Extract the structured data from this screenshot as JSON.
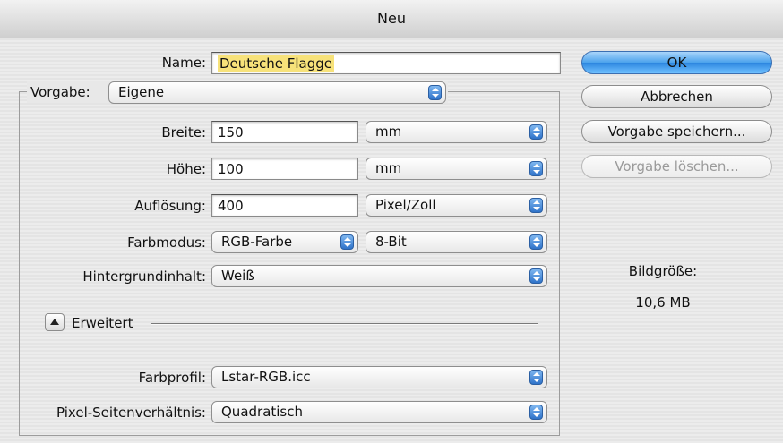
{
  "window": {
    "title": "Neu"
  },
  "name_field": {
    "label": "Name:",
    "value": "Deutsche Flagge"
  },
  "preset": {
    "label": "Vorgabe:",
    "value": "Eigene"
  },
  "width": {
    "label": "Breite:",
    "value": "150",
    "unit": "mm"
  },
  "height": {
    "label": "Höhe:",
    "value": "100",
    "unit": "mm"
  },
  "resolution": {
    "label": "Auflösung:",
    "value": "400",
    "unit": "Pixel/Zoll"
  },
  "color_mode": {
    "label": "Farbmodus:",
    "value": "RGB-Farbe",
    "depth": "8-Bit"
  },
  "background": {
    "label": "Hintergrundinhalt:",
    "value": "Weiß"
  },
  "advanced": {
    "label": "Erweitert"
  },
  "color_profile": {
    "label": "Farbprofil:",
    "value": "Lstar-RGB.icc"
  },
  "pixel_aspect": {
    "label": "Pixel-Seitenverhältnis:",
    "value": "Quadratisch"
  },
  "buttons": {
    "ok": "OK",
    "cancel": "Abbrechen",
    "save_preset": "Vorgabe speichern...",
    "delete_preset": "Vorgabe löschen..."
  },
  "image_size": {
    "label": "Bildgröße:",
    "value": "10,6 MB"
  },
  "colors": {
    "accent": "#2c86e0",
    "highlight": "#f7e27a"
  }
}
